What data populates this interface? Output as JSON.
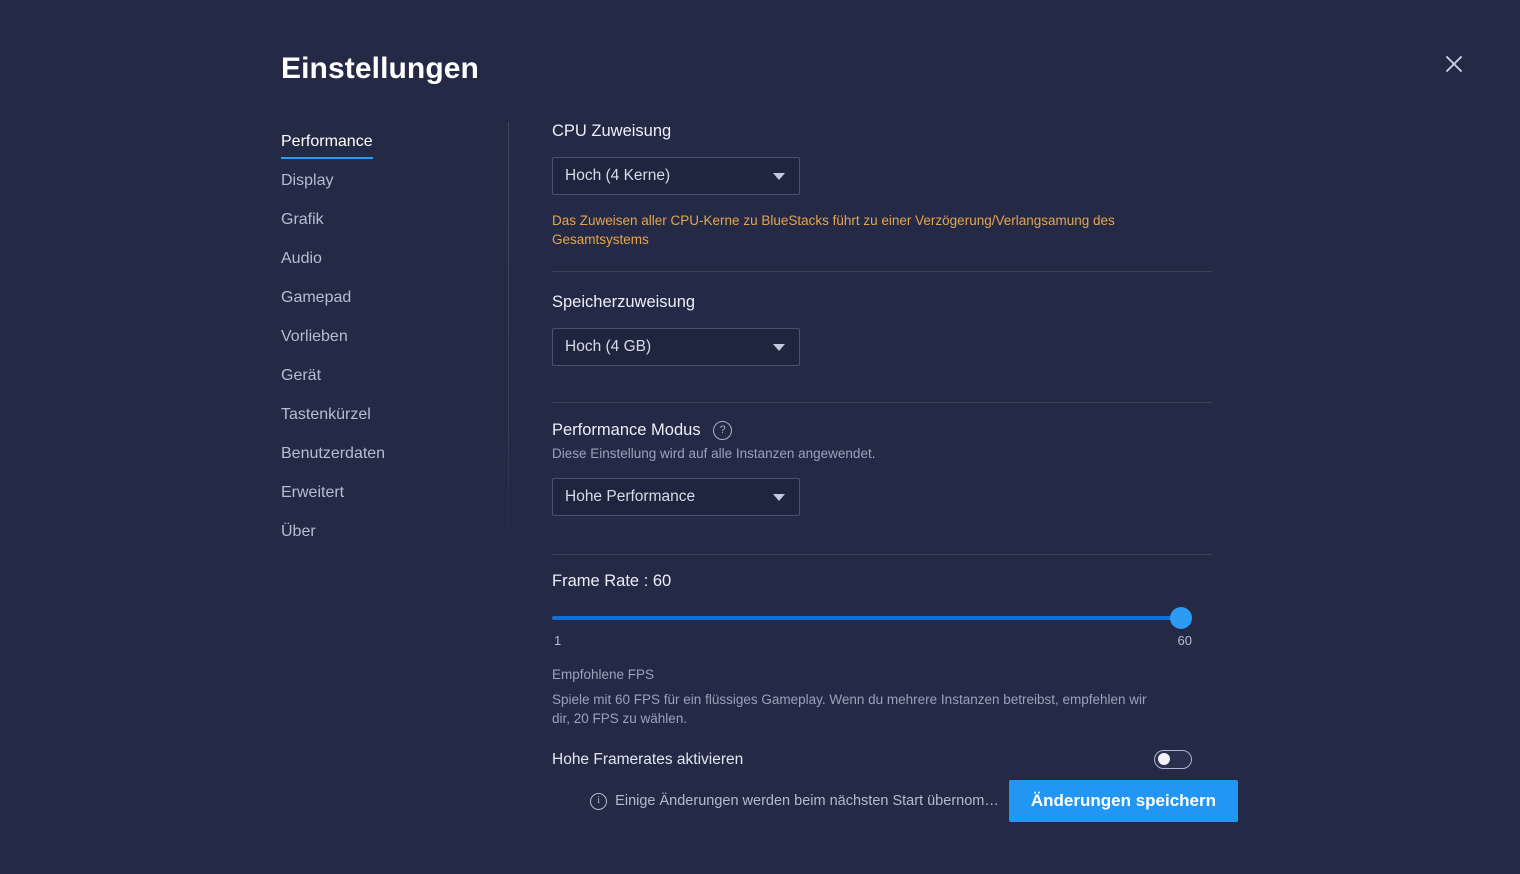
{
  "window": {
    "title": "Einstellungen",
    "close_icon": "close-icon"
  },
  "sidebar": {
    "items": [
      {
        "label": "Performance",
        "active": true
      },
      {
        "label": "Display",
        "active": false
      },
      {
        "label": "Grafik",
        "active": false
      },
      {
        "label": "Audio",
        "active": false
      },
      {
        "label": "Gamepad",
        "active": false
      },
      {
        "label": "Vorlieben",
        "active": false
      },
      {
        "label": "Gerät",
        "active": false
      },
      {
        "label": "Tastenkürzel",
        "active": false
      },
      {
        "label": "Benutzerdaten",
        "active": false
      },
      {
        "label": "Erweitert",
        "active": false
      },
      {
        "label": "Über",
        "active": false
      }
    ]
  },
  "content": {
    "cpu": {
      "label": "CPU Zuweisung",
      "value": "Hoch (4 Kerne)",
      "warning": "Das Zuweisen aller CPU-Kerne zu BlueStacks  führt zu einer Verzögerung/Verlangsamung des Gesamtsystems"
    },
    "memory": {
      "label": "Speicherzuweisung",
      "value": "Hoch (4 GB)"
    },
    "performance_mode": {
      "label": "Performance Modus",
      "help_icon": "question-mark-icon",
      "description": "Diese Einstellung wird auf alle Instanzen angewendet.",
      "value": "Hohe Performance"
    },
    "frame_rate": {
      "label": "Frame Rate : 60",
      "value": 60,
      "min": 1,
      "max": 60,
      "min_label": "1",
      "max_label": "60",
      "recommend_title": "Empfohlene FPS",
      "recommend_text": "Spiele mit 60 FPS für ein flüssiges Gameplay. Wenn du mehrere Instanzen betreibst, empfehlen wir dir, 20 FPS zu wählen.",
      "high_fps_label": "Hohe Framerates aktivieren",
      "high_fps_enabled": false
    }
  },
  "footer": {
    "info_icon": "info-icon",
    "note": "Einige Änderungen werden beim nächsten Start übernom…",
    "save_label": "Änderungen speichern"
  },
  "colors": {
    "background": "#242a45",
    "accent_blue": "#2196f3",
    "warning_orange": "#e6a44f",
    "slider_fill": "#1271d8"
  }
}
